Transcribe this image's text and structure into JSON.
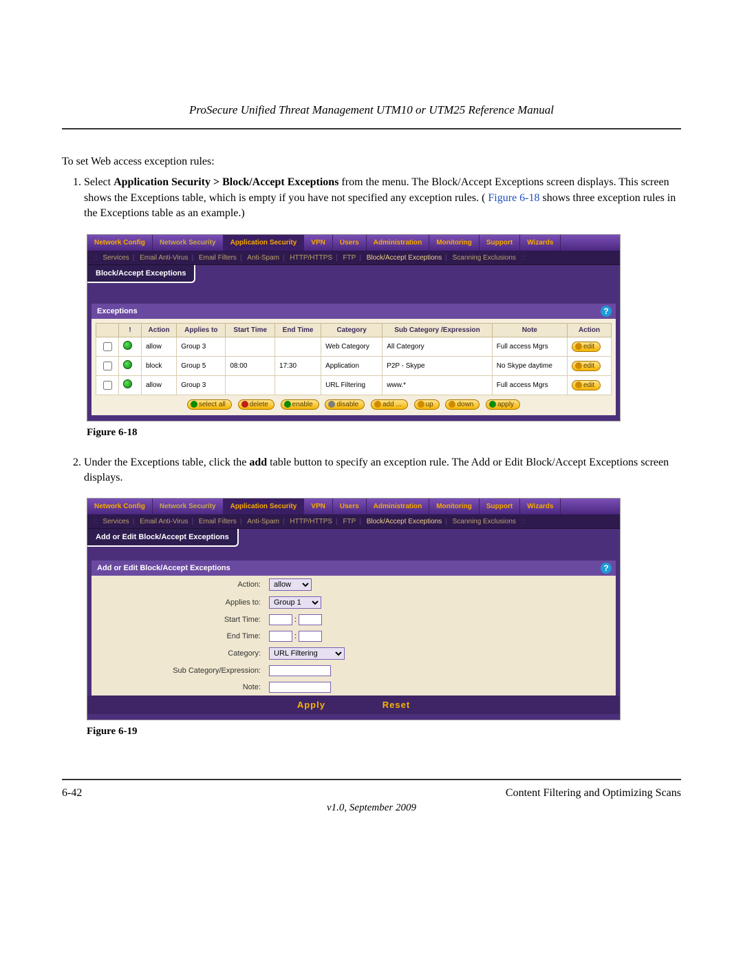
{
  "header": {
    "title": "ProSecure Unified Threat Management UTM10 or UTM25 Reference Manual"
  },
  "intro": "To set Web access exception rules:",
  "step1": {
    "lead": "1.",
    "t1": "Select ",
    "bold1": "Application Security > Block/Accept Exceptions",
    "t2": " from the menu. The Block/Accept Exceptions screen displays. This screen shows the Exceptions table, which is empty if you have not specified any exception rules. (",
    "figref": "Figure 6-18",
    "t3": " shows three exception rules in the Exceptions table as an example.)"
  },
  "step2": {
    "lead": "2.",
    "t1": "Under the Exceptions table, click the ",
    "bold1": "add",
    "t2": " table button to specify an exception rule. The Add or Edit Block/Accept Exceptions screen displays."
  },
  "captions": {
    "fig1": "Figure 6-18",
    "fig2": "Figure 6-19"
  },
  "nav": {
    "tab_network_config": "Network Config",
    "tab_network_security": "Network Security",
    "tab_application_security": "Application Security",
    "tab_vpn": "VPN",
    "tab_users": "Users",
    "tab_administration": "Administration",
    "tab_monitoring": "Monitoring",
    "tab_support": "Support",
    "tab_wizards": "Wizards"
  },
  "subnav": {
    "services": "Services",
    "email_av": "Email Anti-Virus",
    "email_filters": "Email Filters",
    "anti_spam": "Anti-Spam",
    "http": "HTTP/HTTPS",
    "ftp": "FTP",
    "bae": "Block/Accept Exceptions",
    "scan_excl": "Scanning Exclusions"
  },
  "fig1": {
    "pagetab": "Block/Accept Exceptions",
    "panel_title": "Exceptions",
    "columns": {
      "c1": "!",
      "c2": "Action",
      "c3": "Applies to",
      "c4": "Start Time",
      "c5": "End Time",
      "c6": "Category",
      "c7": "Sub Category /Expression",
      "c8": "Note",
      "c9": "Action"
    },
    "rows": [
      {
        "action": "allow",
        "applies": "Group 3",
        "start": "",
        "end": "",
        "cat": "Web Category",
        "sub": "All Category",
        "note": "Full access Mgrs",
        "edit": "edit"
      },
      {
        "action": "block",
        "applies": "Group 5",
        "start": "08:00",
        "end": "17:30",
        "cat": "Application",
        "sub": "P2P - Skype",
        "note": "No Skype daytime",
        "edit": "edit"
      },
      {
        "action": "allow",
        "applies": "Group 3",
        "start": "",
        "end": "",
        "cat": "URL Filtering",
        "sub": "www.*",
        "note": "Full access Mgrs",
        "edit": "edit"
      }
    ],
    "buttons": {
      "select_all": "select all",
      "delete": "delete",
      "enable": "enable",
      "disable": "disable",
      "add": "add ...",
      "up": "up",
      "down": "down",
      "apply": "apply"
    }
  },
  "fig2": {
    "pagetab": "Add or Edit Block/Accept Exceptions",
    "panel_title": "Add or Edit Block/Accept Exceptions",
    "labels": {
      "action": "Action:",
      "applies": "Applies to:",
      "start": "Start Time:",
      "end": "End Time:",
      "category": "Category:",
      "subcat": "Sub Category/Expression:",
      "note": "Note:"
    },
    "values": {
      "action": "allow",
      "applies": "Group 1",
      "start_h": "",
      "start_m": "",
      "end_h": "",
      "end_m": "",
      "category": "URL Filtering",
      "subcat": "",
      "note": ""
    },
    "apply": "Apply",
    "reset": "Reset"
  },
  "footer": {
    "pg": "6-42",
    "chapter": "Content Filtering and Optimizing Scans",
    "version": "v1.0, September 2009"
  }
}
